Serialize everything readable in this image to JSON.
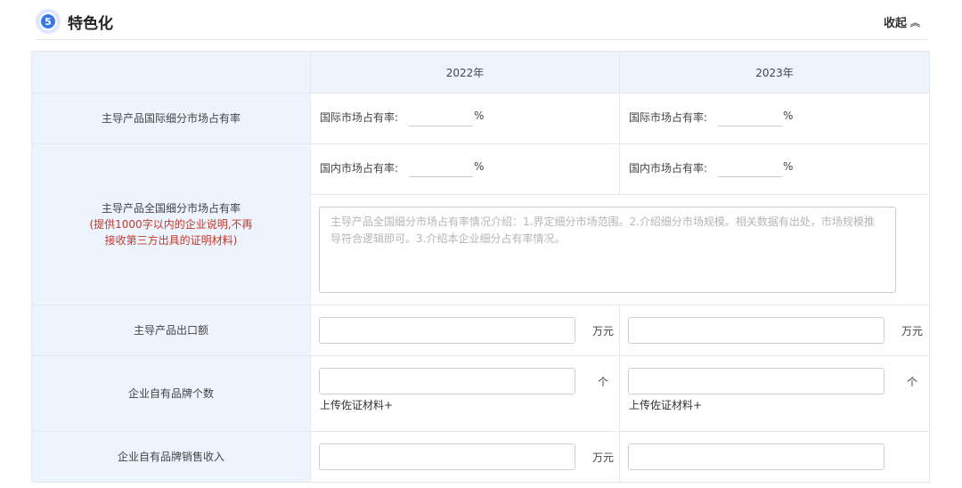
{
  "section": {
    "number": "5",
    "title": "特色化",
    "collapse_label": "收起"
  },
  "years": [
    "2022年",
    "2023年"
  ],
  "rows": {
    "intl_share": {
      "label": "主导产品国际细分市场占有率",
      "field_label": "国际市场占有率:",
      "unit": "%"
    },
    "national_share": {
      "label": "主导产品全国细分市场占有率",
      "note": "(提供1000字以内的企业说明,不再接收第三方出具的证明材料)",
      "field_label": "国内市场占有率:",
      "unit": "%",
      "textarea_placeholder": "主导产品全国细分市场占有率情况介绍：1.界定细分市场范围。2.介绍细分市场规模。相关数据有出处，市场规模推导符合逻辑即可。3.介绍本企业细分占有率情况。"
    },
    "export": {
      "label": "主导产品出口额",
      "unit": "万元"
    },
    "brand_count": {
      "label": "企业自有品牌个数",
      "unit": "个",
      "upload_label": "上传佐证材料+"
    },
    "brand_revenue": {
      "label": "企业自有品牌销售收入",
      "unit": "万元"
    }
  }
}
